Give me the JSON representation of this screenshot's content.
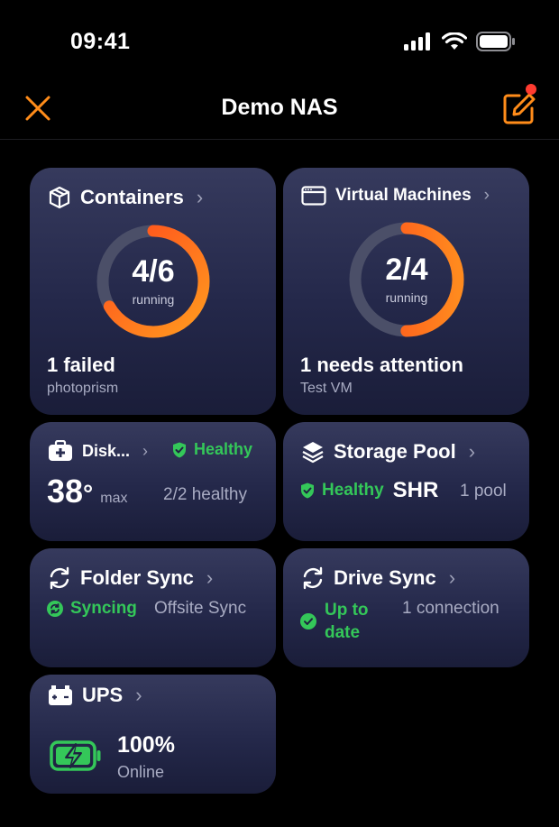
{
  "status": {
    "time": "09:41"
  },
  "nav": {
    "title": "Demo NAS"
  },
  "cards": {
    "containers": {
      "title": "Containers",
      "ratio": "4/6",
      "ratio_label": "running",
      "running": 4,
      "total": 6,
      "primary": "1 failed",
      "secondary": "photoprism"
    },
    "vms": {
      "title": "Virtual Machines",
      "ratio": "2/4",
      "ratio_label": "running",
      "running": 2,
      "total": 4,
      "primary": "1 needs attention",
      "secondary": "Test VM"
    },
    "disks": {
      "title": "Disk...",
      "status": "Healthy",
      "temp": "38",
      "degree": "°",
      "temp_label": "max",
      "summary": "2/2 healthy"
    },
    "storage": {
      "title": "Storage Pool",
      "status": "Healthy",
      "raid": "SHR",
      "pools": "1 pool"
    },
    "folder_sync": {
      "title": "Folder Sync",
      "status": "Syncing",
      "target": "Offsite Sync"
    },
    "drive_sync": {
      "title": "Drive Sync",
      "status_line1": "Up to",
      "status_line2": "date",
      "connections": "1 connection"
    },
    "ups": {
      "title": "UPS",
      "charge": "100%",
      "charge_fraction": 1.0,
      "state": "Online"
    }
  },
  "colors": {
    "accent": "#ff8c1a",
    "ring_start": "#ff9a1f",
    "ring_end": "#ff4a1c",
    "ring_track": "#4b4f68",
    "healthy": "#34c759",
    "badge": "#ff3b30"
  },
  "icons": [
    "close-icon",
    "compose-icon",
    "box-icon",
    "window-icon",
    "medkit-icon",
    "shield-check-icon",
    "layers-icon",
    "sync-icon",
    "check-circle-icon",
    "battery-charging-icon",
    "chevron-right-icon"
  ]
}
